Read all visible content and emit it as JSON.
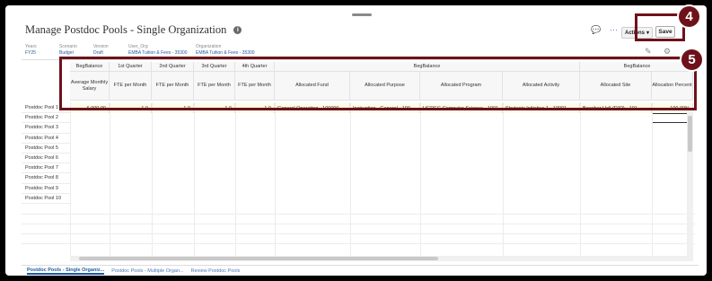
{
  "page": {
    "title": "Manage Postdoc Pools - Single Organization"
  },
  "toolbar": {
    "actions_label": "Actions",
    "save_label": "Save",
    "more_label": "···"
  },
  "pov": [
    {
      "label": "Years",
      "value": "FY25"
    },
    {
      "label": "Scenario",
      "value": "Budget"
    },
    {
      "label": "Version",
      "value": "Draft"
    },
    {
      "label": "User_Org",
      "value": "EMBA Tuition & Fees - 35300"
    },
    {
      "label": "Organization",
      "value": "EMBA Tuition & Fees - 35300"
    }
  ],
  "grid": {
    "top_headers": [
      "BegBalance",
      "1st Quarter",
      "2nd Quarter",
      "3rd Quarter",
      "4th Quarter",
      "BegBalance",
      "BegBalance"
    ],
    "sub_headers": [
      "Average Monthly Salary",
      "FTE per Month",
      "FTE per Month",
      "FTE per Month",
      "FTE per Month",
      "Allocated Fund",
      "Allocated Purpose",
      "Allocated Program",
      "Allocated Activity",
      "Allocated Site",
      "Allocation Percent"
    ],
    "row_headers": [
      "Postdoc Pool 1",
      "Postdoc Pool 2",
      "Postdoc Pool 3",
      "Postdoc Pool 4",
      "Postdoc Pool 5",
      "Postdoc Pool 6",
      "Postdoc Pool 7",
      "Postdoc Pool 8",
      "Postdoc Pool 9",
      "Postdoc Pool 10"
    ],
    "row1": [
      "6,000.00",
      "1.0",
      "1.0",
      "1.0",
      "1.0",
      "General Operating - 100000",
      "Instruction - General - 100",
      "UGDEG Computer Science - 1001",
      "Strategic Initiative 1 - 10001",
      "Beecher Hall (D32) - 101",
      "100.00%"
    ]
  },
  "tabs": [
    "Postdoc Pools - Single Organiz...",
    "Postdoc Pools - Multiple Organ...",
    "Review Postdoc Pools"
  ],
  "callouts": [
    "4",
    "5"
  ],
  "colors": {
    "callout": "#6e1219",
    "link": "#1d5aa8",
    "input_cell": "#fdfde8"
  }
}
